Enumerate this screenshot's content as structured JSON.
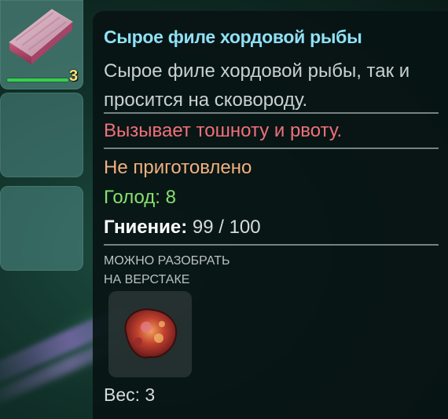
{
  "inventory": {
    "slots": [
      {
        "item_icon": "raw-fish-fillet-icon",
        "stack_count": "3",
        "durability": 0.78
      },
      {
        "empty": true
      },
      {
        "empty": true
      }
    ]
  },
  "tooltip": {
    "title": "Сырое филе хордовой рыбы",
    "description": "Сырое филе хордовой рыбы, так и просится на сковороду.",
    "effect": "Вызывает тошноту и рвоту.",
    "cooked_status": "Не приготовлено",
    "hunger_label": "Голод:",
    "hunger_value": "8",
    "decay_label": "Гниение:",
    "decay_value": "99 / 100",
    "salvage_line1": "МОЖНО РАЗОБРАТЬ",
    "salvage_line2": "НА ВЕРСТАКЕ",
    "salvage_icon": "organic-matter-icon",
    "weight_label": "Вес:",
    "weight_value": "3"
  },
  "colors": {
    "title": "#8fe0f5",
    "effect": "#f0707a",
    "cooked_status": "#f2b07e",
    "hunger": "#86e070",
    "stack_count": "#ffe27a",
    "durability_bar": "#35d04a"
  }
}
